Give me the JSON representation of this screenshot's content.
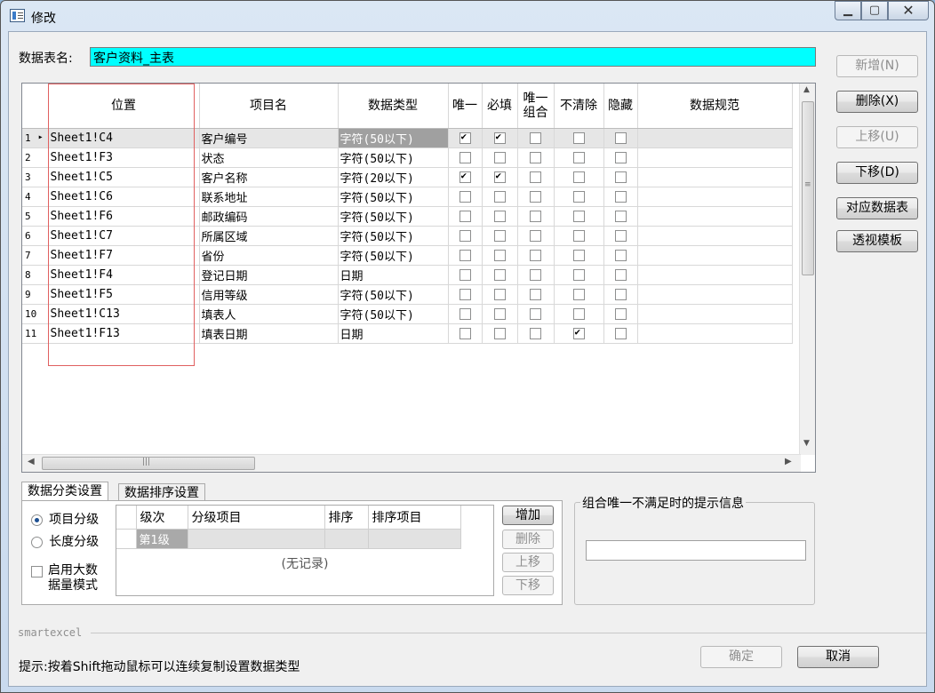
{
  "window": {
    "title": "修改",
    "min_label": "▁",
    "max_label": "▢",
    "close_label": "✕"
  },
  "form": {
    "table_name_label": "数据表名:",
    "table_name_value": "客户资料_主表"
  },
  "grid": {
    "columns": [
      "位置",
      "项目名",
      "数据类型",
      "唯一",
      "必填",
      "唯一\n组合",
      "不清除",
      "隐藏",
      "数据规范"
    ],
    "rows": [
      {
        "n": "1",
        "pos": "Sheet1!C4",
        "name": "客户编号",
        "type": "字符(50以下)",
        "unique": true,
        "required": true,
        "combo": false,
        "noclear": false,
        "hidden": false
      },
      {
        "n": "2",
        "pos": "Sheet1!F3",
        "name": "状态",
        "type": "字符(50以下)",
        "unique": false,
        "required": false,
        "combo": false,
        "noclear": false,
        "hidden": false
      },
      {
        "n": "3",
        "pos": "Sheet1!C5",
        "name": "客户名称",
        "type": "字符(20以下)",
        "unique": true,
        "required": true,
        "combo": false,
        "noclear": false,
        "hidden": false
      },
      {
        "n": "4",
        "pos": "Sheet1!C6",
        "name": "联系地址",
        "type": "字符(50以下)",
        "unique": false,
        "required": false,
        "combo": false,
        "noclear": false,
        "hidden": false
      },
      {
        "n": "5",
        "pos": "Sheet1!F6",
        "name": "邮政编码",
        "type": "字符(50以下)",
        "unique": false,
        "required": false,
        "combo": false,
        "noclear": false,
        "hidden": false
      },
      {
        "n": "6",
        "pos": "Sheet1!C7",
        "name": "所属区域",
        "type": "字符(50以下)",
        "unique": false,
        "required": false,
        "combo": false,
        "noclear": false,
        "hidden": false
      },
      {
        "n": "7",
        "pos": "Sheet1!F7",
        "name": "省份",
        "type": "字符(50以下)",
        "unique": false,
        "required": false,
        "combo": false,
        "noclear": false,
        "hidden": false
      },
      {
        "n": "8",
        "pos": "Sheet1!F4",
        "name": "登记日期",
        "type": "日期",
        "unique": false,
        "required": false,
        "combo": false,
        "noclear": false,
        "hidden": false
      },
      {
        "n": "9",
        "pos": "Sheet1!F5",
        "name": "信用等级",
        "type": "字符(50以下)",
        "unique": false,
        "required": false,
        "combo": false,
        "noclear": false,
        "hidden": false
      },
      {
        "n": "10",
        "pos": "Sheet1!C13",
        "name": "填表人",
        "type": "字符(50以下)",
        "unique": false,
        "required": false,
        "combo": false,
        "noclear": false,
        "hidden": false
      },
      {
        "n": "11",
        "pos": "Sheet1!F13",
        "name": "填表日期",
        "type": "日期",
        "unique": false,
        "required": false,
        "combo": false,
        "noclear": true,
        "hidden": false
      }
    ]
  },
  "side_buttons": {
    "add": "新增(N)",
    "delete": "删除(X)",
    "up": "上移(U)",
    "down": "下移(D)",
    "map_table": "对应数据表",
    "pivot": "透视模板"
  },
  "tabs": {
    "classify": "数据分类设置",
    "sort": "数据排序设置"
  },
  "classify": {
    "radio_item": "项目分级",
    "radio_length": "长度分级",
    "bigdata_line1": "启用大数",
    "bigdata_line2": "据量模式",
    "sub_columns": [
      "级次",
      "分级项目",
      "排序",
      "排序项目"
    ],
    "first_level": "第1级",
    "no_record": "(无记录)",
    "btn_add": "增加",
    "btn_delete": "删除",
    "btn_up": "上移",
    "btn_down": "下移"
  },
  "combo_msg": {
    "label": "组合唯一不满足时的提示信息",
    "value": ""
  },
  "footer": {
    "brand": "smartexcel",
    "hint": "提示:按着Shift拖动鼠标可以连续复制设置数据类型",
    "ok": "确定",
    "cancel": "取消"
  }
}
